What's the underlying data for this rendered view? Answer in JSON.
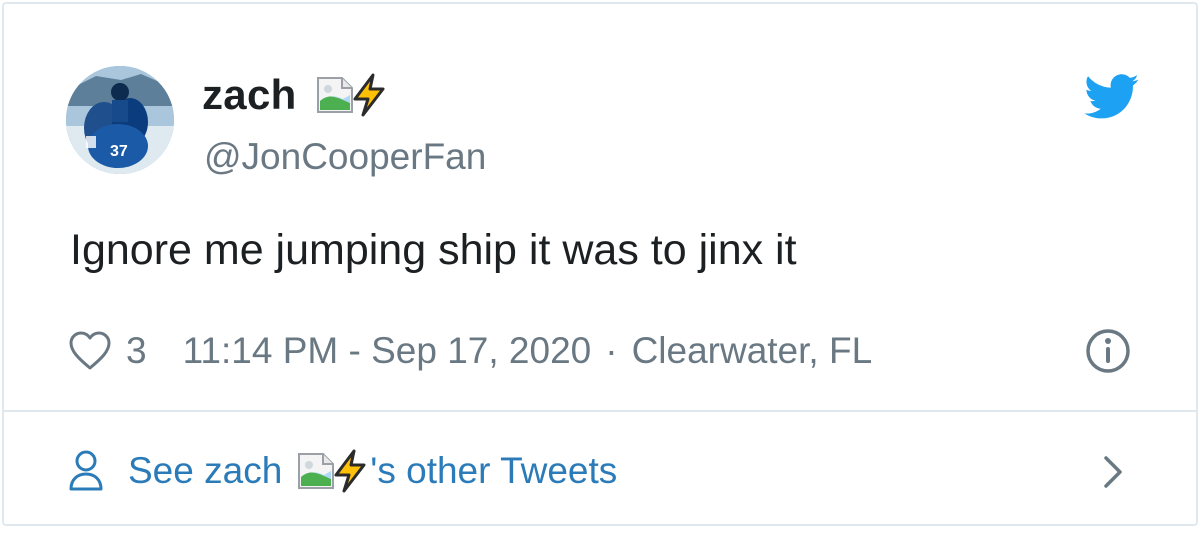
{
  "user": {
    "display_name": "zach",
    "handle": "@JonCooperFan",
    "avatar_icon": "avatar-hockey-photo",
    "name_icons": [
      "broken-image-icon",
      "lightning-bolt-icon"
    ]
  },
  "tweet": {
    "text": "Ignore me jumping ship it was to jinx it",
    "like_count": "3",
    "timestamp": "11:14 PM - Sep 17, 2020",
    "separator": "·",
    "location": "Clearwater, FL"
  },
  "footer": {
    "prefix": "See zach",
    "suffix": "'s other Tweets"
  },
  "colors": {
    "twitter_blue": "#1da1f2",
    "link_blue": "#2b7bb9",
    "meta_gray": "#697882",
    "border": "#e1e8ed"
  }
}
